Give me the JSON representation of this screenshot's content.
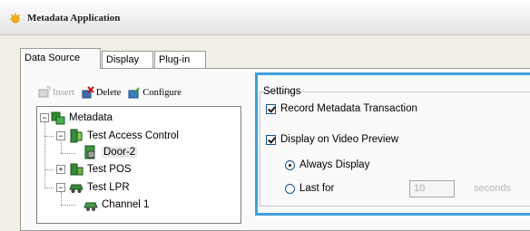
{
  "window": {
    "title": "Metadata Application",
    "icon": "sun-app-icon"
  },
  "tabs": [
    {
      "label": "Data Source",
      "active": true
    },
    {
      "label": "Display",
      "active": false
    },
    {
      "label": "Plug-in",
      "active": false
    }
  ],
  "toolbar": {
    "insert_label": "Insert",
    "delete_label": "Delete",
    "configure_label": "Configure"
  },
  "tree": {
    "root": {
      "label": "Metadata",
      "icon": "metadata-icon"
    },
    "items": [
      {
        "label": "Test Access Control",
        "icon": "access-control-icon"
      },
      {
        "label": "Door-2",
        "icon": "door-icon",
        "selected": true
      },
      {
        "label": "Test POS",
        "icon": "pos-icon"
      },
      {
        "label": "Test LPR",
        "icon": "lpr-icon"
      },
      {
        "label": "Channel 1",
        "icon": "channel-icon"
      }
    ]
  },
  "settings": {
    "group_label": "Settings",
    "record_label": "Record Metadata Transaction",
    "record_checked": true,
    "display_label": "Display on Video Preview",
    "display_checked": true,
    "always_label": "Always Display",
    "always_selected": true,
    "lastfor_label": "Last for",
    "lastfor_selected": false,
    "lastfor_value": "10",
    "lastfor_unit": "seconds"
  },
  "colors": {
    "highlight_border": "#3da1dd",
    "tab_panel_bg": "#fafafa",
    "window_bg": "#f1efe6"
  }
}
